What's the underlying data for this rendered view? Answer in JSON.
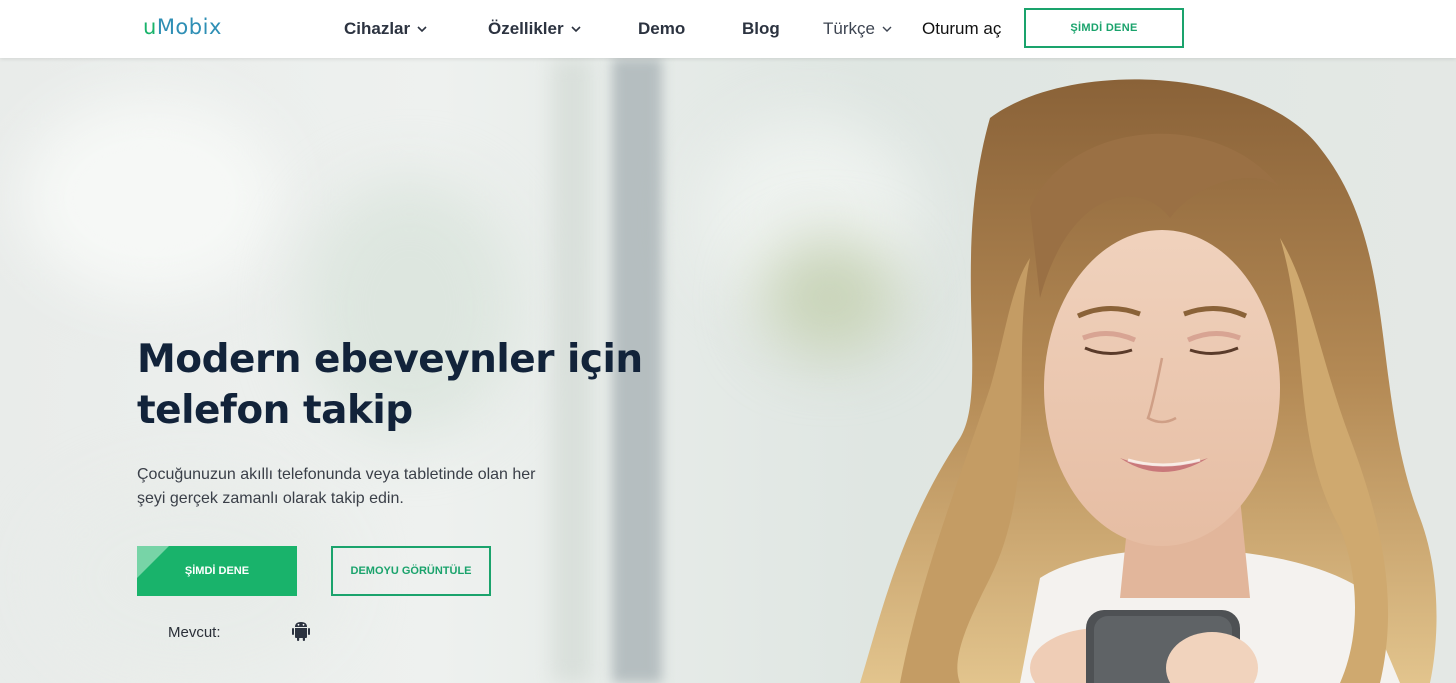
{
  "header": {
    "logo": {
      "part1": "u",
      "part2": "Mobix"
    },
    "nav": [
      {
        "label": "Cihazlar",
        "has_dropdown": true
      },
      {
        "label": "Özellikler",
        "has_dropdown": true
      },
      {
        "label": "Demo",
        "has_dropdown": false
      },
      {
        "label": "Blog",
        "has_dropdown": false
      }
    ],
    "language": "Türkçe",
    "login": "Oturum aç",
    "cta": "ŞİMDİ DENE"
  },
  "hero": {
    "title_line1": "Modern ebeveynler için",
    "title_line2": "telefon takip",
    "subtitle_line1": "Çocuğunuzun akıllı telefonunda veya tabletinde olan her",
    "subtitle_line2": "şeyi gerçek zamanlı olarak takip edin.",
    "primary_button": "ŞİMDİ DENE",
    "secondary_button": "DEMOYU GÖRÜNTÜLE",
    "available_label": "Mevcut:",
    "available_icon": "android-icon"
  },
  "colors": {
    "brand_green": "#19b36b",
    "brand_blue": "#2f8fb5",
    "title": "#12233a"
  }
}
